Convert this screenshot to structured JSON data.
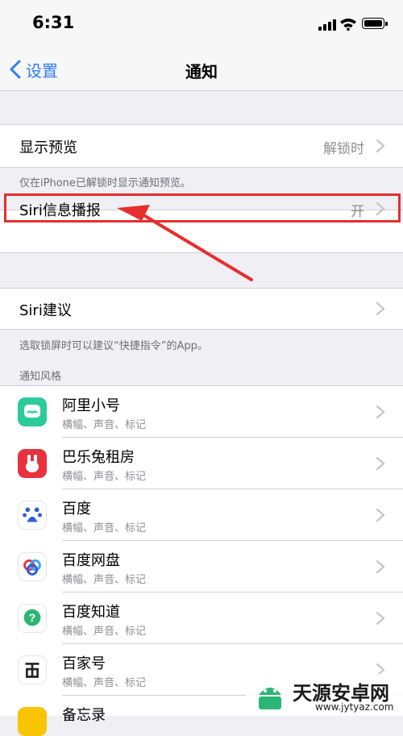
{
  "status": {
    "time": "6:31"
  },
  "nav": {
    "back_label": "设置",
    "title": "通知"
  },
  "preview": {
    "label": "显示预览",
    "value": "解锁时",
    "note": "仅在iPhone已解锁时显示通知预览。"
  },
  "announce": {
    "label": "Siri信息播报",
    "value": "开"
  },
  "siri_suggest": {
    "label": "Siri建议",
    "note": "选取锁屏时可以建议“快捷指令”的App。"
  },
  "section_header": "通知风格",
  "apps": [
    {
      "name": "阿里小号",
      "sub": "横幅、声音、标记",
      "icon": "ali-xiaohao-icon",
      "color": "#2ccb9a"
    },
    {
      "name": "巴乐兔租房",
      "sub": "横幅、声音、标记",
      "icon": "baletu-icon",
      "color": "#e8333f"
    },
    {
      "name": "百度",
      "sub": "横幅、声音、标记",
      "icon": "baidu-icon",
      "color": "#2f5cd9"
    },
    {
      "name": "百度网盘",
      "sub": "横幅、声音、标记",
      "icon": "baidu-netdisk-icon",
      "color": "#3aa0f0"
    },
    {
      "name": "百度知道",
      "sub": "横幅、声音、标记",
      "icon": "baidu-zhidao-icon",
      "color": "#2bb673"
    },
    {
      "name": "百家号",
      "sub": "横幅、声音、标记",
      "icon": "baijiahao-icon",
      "color": "#222222"
    },
    {
      "name": "备忘录",
      "sub": "",
      "icon": "notes-icon",
      "color": "#f7c600"
    }
  ],
  "watermark": {
    "name": "天源安卓网",
    "url": "www.jytyaz.com"
  },
  "colors": {
    "accent": "#2f7cf6",
    "highlight": "#e62e2e",
    "background": "#efeff4"
  }
}
